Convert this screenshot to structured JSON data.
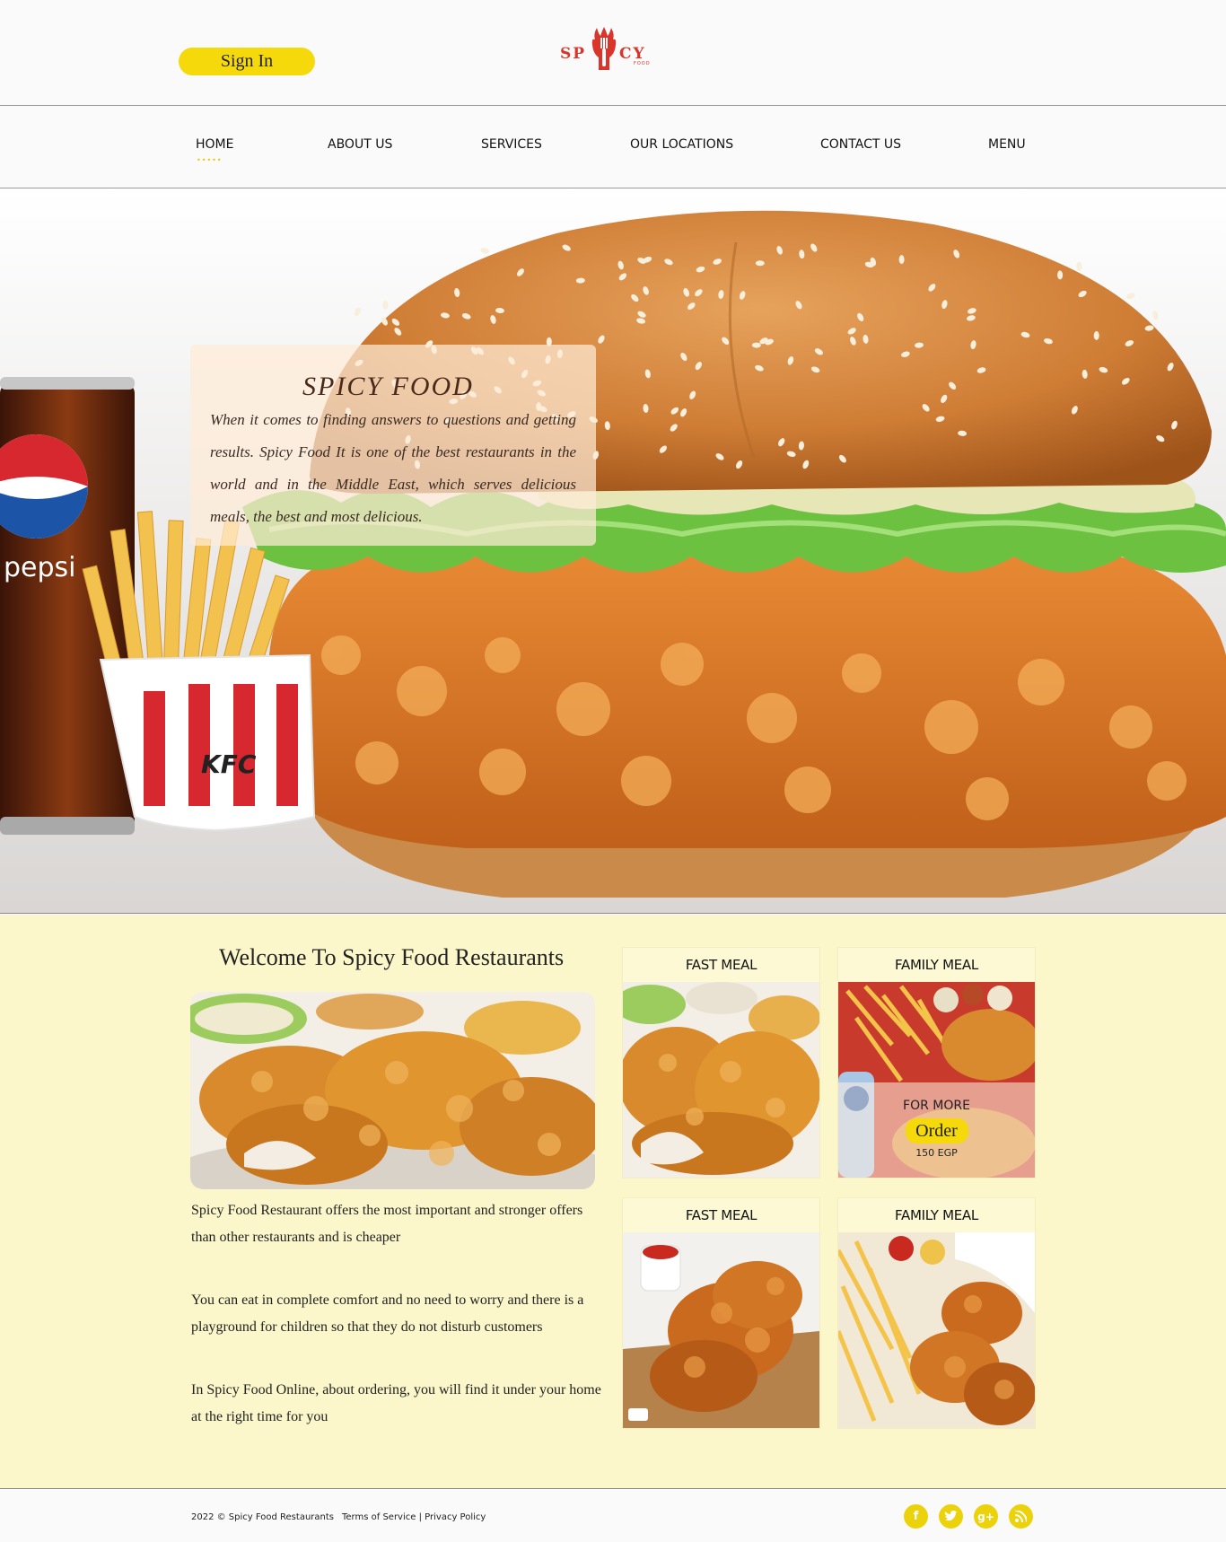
{
  "header": {
    "sign_in": "Sign In",
    "logo": {
      "left": "SP",
      "right": "CY",
      "sub": "FOOD"
    }
  },
  "nav": {
    "items": [
      "HOME",
      "ABOUT US",
      "SERVICES",
      "OUR LOCATIONS",
      "CONTACT US",
      "MENU"
    ],
    "active": "HOME",
    "active_dots": "•••••"
  },
  "hero": {
    "title": "SPICY FOOD",
    "text": "When it comes to finding answers to questions and getting results. Spicy Food It is one of the best restaurants in the world and in the Middle East, which serves delicious meals, the best and most delicious.",
    "can_brand": "pepsi",
    "fries_brand": "KFC"
  },
  "main": {
    "welcome": "Welcome To Spicy Food Restaurants",
    "paragraphs": [
      "Spicy Food Restaurant offers the most important and stronger offers than other restaurants and is cheaper",
      "You can eat in complete comfort and no need to worry and there is a playground for children so that they do not disturb customers",
      "In Spicy Food Online, about ordering, you will find it under your home at the right time for you"
    ],
    "cards": [
      {
        "title": "FAST MEAL"
      },
      {
        "title": "FAMILY MEAL",
        "overlay": {
          "more": "FOR MORE",
          "order": "Order",
          "price": "150 EGP"
        }
      },
      {
        "title": "FAST MEAL"
      },
      {
        "title": "FAMILY MEAL"
      }
    ]
  },
  "footer": {
    "copyright": "2022 © Spicy Food Restaurants",
    "terms": "Terms of Service",
    "separator": "|",
    "privacy": "Privacy Policy",
    "social": [
      "facebook-icon",
      "twitter-icon",
      "google-plus-icon",
      "rss-icon"
    ]
  },
  "colors": {
    "accent": "#f5d90a",
    "brand_red": "#d9352b",
    "main_bg": "#fbf7cb"
  }
}
